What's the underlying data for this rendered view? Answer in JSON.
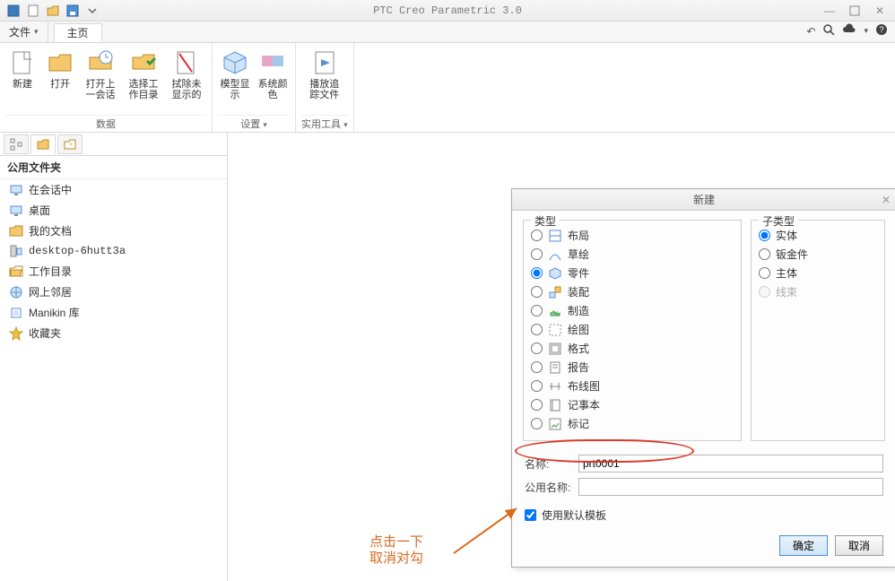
{
  "app_title": "PTC Creo Parametric 3.0",
  "menu": {
    "file": "文件",
    "home": "主页"
  },
  "ribbon": {
    "group_data": "数据",
    "group_settings": "设置",
    "group_tools": "实用工具",
    "new": "新建",
    "open": "打开",
    "open_last": "打开上一会话",
    "workdir": "选择工作目录",
    "erase": "拭除未显示的",
    "model_disp": "模型显示",
    "sys_color": "系统颜色",
    "play_trace": "播放追踪文件"
  },
  "sidebar": {
    "header": "公用文件夹",
    "items": [
      {
        "label": "在会话中"
      },
      {
        "label": "桌面"
      },
      {
        "label": "我的文档"
      },
      {
        "label": "desktop-6hutt3a"
      },
      {
        "label": "工作目录"
      },
      {
        "label": "网上邻居"
      },
      {
        "label": "Manikin 库"
      },
      {
        "label": "收藏夹"
      }
    ]
  },
  "dialog": {
    "title": "新建",
    "type_legend": "类型",
    "subtype_legend": "子类型",
    "types": [
      {
        "label": "布局"
      },
      {
        "label": "草绘"
      },
      {
        "label": "零件"
      },
      {
        "label": "装配"
      },
      {
        "label": "制造"
      },
      {
        "label": "绘图"
      },
      {
        "label": "格式"
      },
      {
        "label": "报告"
      },
      {
        "label": "布线图"
      },
      {
        "label": "记事本"
      },
      {
        "label": "标记"
      }
    ],
    "subtypes": [
      {
        "label": "实体",
        "disabled": false
      },
      {
        "label": "钣金件",
        "disabled": false
      },
      {
        "label": "主体",
        "disabled": false
      },
      {
        "label": "线束",
        "disabled": true
      }
    ],
    "name_label": "名称:",
    "name_value": "prt0001",
    "common_label": "公用名称:",
    "common_value": "",
    "use_template": "使用默认模板",
    "ok": "确定",
    "cancel": "取消"
  },
  "annotation": {
    "line1": "点击一下",
    "line2": "取消对勾"
  }
}
